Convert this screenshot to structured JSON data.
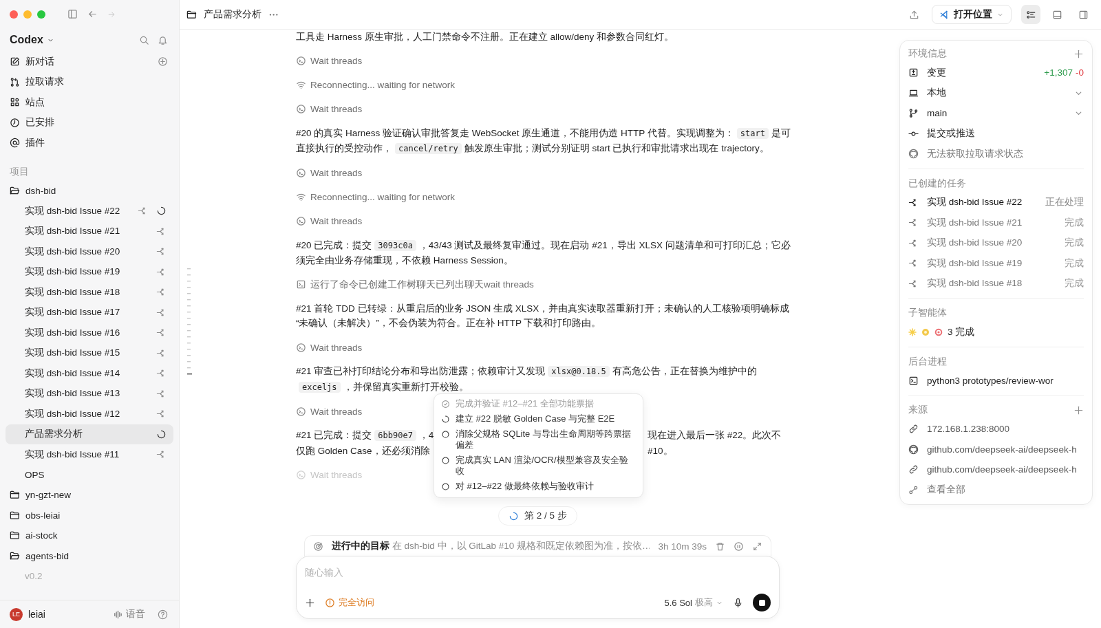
{
  "window": {
    "title": "产品需求分析"
  },
  "app": {
    "name": "Codex"
  },
  "nav": [
    {
      "kind": "new_chat",
      "label": "新对话"
    },
    {
      "kind": "pull_requests",
      "label": "拉取请求"
    },
    {
      "kind": "sites",
      "label": "站点"
    },
    {
      "kind": "scheduled",
      "label": "已安排"
    },
    {
      "kind": "plugins",
      "label": "插件"
    }
  ],
  "projects_heading": "项目",
  "projects": [
    {
      "name": "dsh-bid",
      "expanded": true,
      "children": [
        {
          "title": "实现 dsh-bid Issue #22",
          "worktree": true,
          "running": true,
          "selected": false,
          "dimmed": false
        },
        {
          "title": "实现 dsh-bid Issue #21",
          "worktree": true,
          "running": false,
          "selected": false,
          "dimmed": false
        },
        {
          "title": "实现 dsh-bid Issue #20",
          "worktree": true,
          "running": false,
          "selected": false,
          "dimmed": false
        },
        {
          "title": "实现 dsh-bid Issue #19",
          "worktree": true,
          "running": false,
          "selected": false,
          "dimmed": false
        },
        {
          "title": "实现 dsh-bid Issue #18",
          "worktree": true,
          "running": false,
          "selected": false,
          "dimmed": false
        },
        {
          "title": "实现 dsh-bid Issue #17",
          "worktree": true,
          "running": false,
          "selected": false,
          "dimmed": false
        },
        {
          "title": "实现 dsh-bid Issue #16",
          "worktree": true,
          "running": false,
          "selected": false,
          "dimmed": false
        },
        {
          "title": "实现 dsh-bid Issue #15",
          "worktree": true,
          "running": false,
          "selected": false,
          "dimmed": false
        },
        {
          "title": "实现 dsh-bid Issue #14",
          "worktree": true,
          "running": false,
          "selected": false,
          "dimmed": false
        },
        {
          "title": "实现 dsh-bid Issue #13",
          "worktree": true,
          "running": false,
          "selected": false,
          "dimmed": false
        },
        {
          "title": "实现 dsh-bid Issue #12",
          "worktree": true,
          "running": false,
          "selected": false,
          "dimmed": false
        },
        {
          "title": "产品需求分析",
          "worktree": false,
          "running": true,
          "selected": true,
          "dimmed": false
        },
        {
          "title": "实现 dsh-bid Issue #11",
          "worktree": true,
          "running": false,
          "selected": false,
          "dimmed": false
        },
        {
          "title": "OPS",
          "worktree": false,
          "running": false,
          "selected": false,
          "dimmed": false
        }
      ]
    },
    {
      "name": "yn-gzt-new",
      "expanded": false
    },
    {
      "name": "obs-leiai",
      "expanded": false
    },
    {
      "name": "ai-stock",
      "expanded": false
    },
    {
      "name": "agents-bid",
      "expanded": true,
      "children": [
        {
          "title": "v0.2",
          "worktree": false,
          "running": false,
          "selected": false,
          "dimmed": true
        }
      ]
    }
  ],
  "user": {
    "initials": "LE",
    "name": "leiai"
  },
  "voice_label": "语音",
  "header": {
    "open_button": "打开位置",
    "toggles": [
      {
        "kind": "tasks",
        "on": true
      },
      {
        "kind": "bottom_panel",
        "on": false
      },
      {
        "kind": "side_panel",
        "on": false
      }
    ]
  },
  "messages": [
    {
      "kind": "text",
      "lines": [
        [
          {
            "kind": "text",
            "text": "工具走 Harness 原生审批，人工门禁命令不注册。正在建立 allow/deny 和参数合同红灯。"
          }
        ]
      ]
    },
    {
      "kind": "wait",
      "text": "Wait threads",
      "faded": false
    },
    {
      "kind": "network",
      "text": "Reconnecting... waiting for network",
      "faded": false
    },
    {
      "kind": "wait",
      "text": "Wait threads",
      "faded": false
    },
    {
      "kind": "text",
      "lines": [
        [
          {
            "kind": "text",
            "text": "#20 的真实 Harness 验证确认审批答复走 WebSocket 原生通道，不能用伪造 HTTP 代替。实现调整为："
          },
          {
            "kind": "code",
            "text": "start"
          },
          {
            "kind": "text",
            "text": "是可"
          }
        ],
        [
          {
            "kind": "text",
            "text": "直接执行的受控动作，"
          },
          {
            "kind": "code",
            "text": "cancel/retry"
          },
          {
            "kind": "text",
            "text": "触发原生审批；测试分别证明 start 已执行和审批请求出现在 trajectory。"
          }
        ]
      ]
    },
    {
      "kind": "wait",
      "text": "Wait threads",
      "faded": false
    },
    {
      "kind": "network",
      "text": "Reconnecting... waiting for network",
      "faded": false
    },
    {
      "kind": "wait",
      "text": "Wait threads",
      "faded": false
    },
    {
      "kind": "text",
      "lines": [
        [
          {
            "kind": "text",
            "text": "#20 已完成：提交"
          },
          {
            "kind": "code",
            "text": "3093c0a"
          },
          {
            "kind": "text",
            "text": "，43/43 测试及最终复审通过。现在启动 #21，导出 XLSX 问题清单和可打印汇总；它必"
          }
        ],
        [
          {
            "kind": "text",
            "text": "须完全由业务存储重现，不依赖 Harness Session。"
          }
        ]
      ]
    },
    {
      "kind": "command",
      "text": "运行了命令已创建工作树聊天已列出聊天wait threads",
      "faded": false
    },
    {
      "kind": "text",
      "lines": [
        [
          {
            "kind": "text",
            "text": "#21 首轮 TDD 已转绿：从重启后的业务 JSON 生成 XLSX，并由真实读取器重新打开；未确认的人工核验项明确标成"
          }
        ],
        [
          {
            "kind": "text",
            "text": "“未确认（未解决）”，不会伪装为符合。正在补 HTTP 下载和打印路由。"
          }
        ]
      ]
    },
    {
      "kind": "wait",
      "text": "Wait threads",
      "faded": false
    },
    {
      "kind": "text",
      "lines": [
        [
          {
            "kind": "text",
            "text": "#21 审查已补打印结论分布和导出防泄露；依赖审计又发现"
          },
          {
            "kind": "code",
            "text": "xlsx@0.18.5"
          },
          {
            "kind": "text",
            "text": "有高危公告，正在替换为维护中的"
          }
        ],
        [
          {
            "kind": "code",
            "text": "exceljs"
          },
          {
            "kind": "text",
            "text": "，并保留真实重新打开校验。"
          }
        ]
      ]
    },
    {
      "kind": "wait",
      "text": "Wait threads",
      "faded": false
    },
    {
      "kind": "split",
      "lines": [
        {
          "left": [
            {
              "kind": "text",
              "text": "#21 已完成：提交"
            },
            {
              "kind": "code",
              "text": "6bb90e7"
            },
            {
              "kind": "text",
              "text": "，4"
            }
          ],
          "right": [
            {
              "kind": "text",
              "text": "现在进入最后一张 #22。此次不"
            }
          ]
        },
        {
          "left": [
            {
              "kind": "text",
              "text": "仅跑 Golden Case，还必须消除"
            }
          ],
          "right": [
            {
              "kind": "text",
              "text": "#10。"
            }
          ]
        }
      ]
    },
    {
      "kind": "wait",
      "text": "Wait threads",
      "faded": true
    }
  ],
  "plan": {
    "steps": [
      {
        "kind": "done",
        "text": "完成并验证 #12–#21 全部功能票据"
      },
      {
        "kind": "active",
        "text": "建立 #22 脱敏 Golden Case 与完整 E2E"
      },
      {
        "kind": "pending",
        "text": "消除父规格 SQLite 与导出生命周期等跨票据偏差"
      },
      {
        "kind": "pending",
        "text": "完成真实 LAN 渲染/OCR/模型兼容及安全验收"
      },
      {
        "kind": "pending",
        "text": "对 #12–#22 做最终依赖与验收审计"
      }
    ],
    "progress": "第 2 / 5 步",
    "running": true
  },
  "goal": {
    "label": "进行中的目标",
    "description": "在 dsh-bid 中，以 GitLab #10 规格和既定依赖图为准，按依…",
    "elapsed": "3h 10m 39s"
  },
  "composer": {
    "placeholder": "随心输入",
    "access": "完全访问",
    "model": "5.6 Sol",
    "effort": "极高"
  },
  "environment": {
    "title": "环境信息",
    "rows": [
      {
        "kind": "changes",
        "label": "变更",
        "added": "+1,307",
        "removed": "-0"
      },
      {
        "kind": "location",
        "label": "本地"
      },
      {
        "kind": "branch",
        "label": "main"
      },
      {
        "kind": "commit",
        "label": "提交或推送"
      },
      {
        "kind": "pull_request",
        "label": "无法获取拉取请求状态"
      }
    ]
  },
  "tasks": {
    "title": "已创建的任务",
    "items": [
      {
        "title": "实现 dsh-bid Issue #22",
        "status": "正在处理",
        "active": true
      },
      {
        "title": "实现 dsh-bid Issue #21",
        "status": "完成",
        "active": false
      },
      {
        "title": "实现 dsh-bid Issue #20",
        "status": "完成",
        "active": false
      },
      {
        "title": "实现 dsh-bid Issue #19",
        "status": "完成",
        "active": false
      },
      {
        "title": "实现 dsh-bid Issue #18",
        "status": "完成",
        "active": false
      }
    ]
  },
  "subagents": {
    "title": "子智能体",
    "agents": [
      {
        "kind": "sun",
        "color": "#f7cf4a"
      },
      {
        "kind": "flower",
        "color": "#f3c94c"
      },
      {
        "kind": "ring",
        "color": "#ec6f73"
      }
    ],
    "summary": "3 完成"
  },
  "processes": {
    "title": "后台进程",
    "items": [
      {
        "command": "python3 prototypes/review-wor"
      }
    ]
  },
  "sources": {
    "title": "来源",
    "items": [
      {
        "kind": "link",
        "label": "172.168.1.238:8000"
      },
      {
        "kind": "github",
        "label": "github.com/deepseek-ai/deepseek-h"
      },
      {
        "kind": "link",
        "label": "github.com/deepseek-ai/deepseek-h"
      }
    ],
    "more": "查看全部"
  }
}
